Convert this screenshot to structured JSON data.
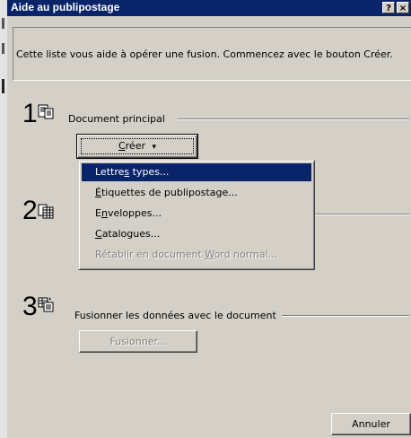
{
  "window": {
    "title": "Aide au publipostage",
    "help_glyph": "?",
    "close_glyph": "×"
  },
  "description": "Cette liste vous aide à opérer une fusion. Commencez avec le bouton Créer.",
  "steps": [
    {
      "number": "1",
      "label": "Document principal",
      "icon": "document-icon"
    },
    {
      "number": "2",
      "label": "",
      "icon": "data-source-icon"
    },
    {
      "number": "3",
      "label": "Fusionner les données avec le document",
      "icon": "merge-icon"
    }
  ],
  "create_button": {
    "label_pre": "",
    "label_key": "C",
    "label_post": "réer",
    "arrow": "▾"
  },
  "create_menu": {
    "items": [
      {
        "pre": "Lettre",
        "key": "s",
        "post": " types...",
        "state": "selected"
      },
      {
        "pre": "",
        "key": "É",
        "post": "tiquettes de publipostage...",
        "state": "normal"
      },
      {
        "pre": "E",
        "key": "n",
        "post": "veloppes...",
        "state": "normal"
      },
      {
        "pre": "",
        "key": "C",
        "post": "atalogues...",
        "state": "normal"
      },
      {
        "pre": "Rétablir en document ",
        "key": "W",
        "post": "ord normal...",
        "state": "disabled"
      }
    ]
  },
  "merge_button": {
    "label": "Fusionner...",
    "state": "disabled"
  },
  "cancel_button": {
    "label": "Annuler"
  },
  "colors": {
    "titlebar": "#0a246a",
    "dialog_face": "#d4d0c8",
    "highlight": "#0a246a",
    "disabled_text": "#808080"
  }
}
